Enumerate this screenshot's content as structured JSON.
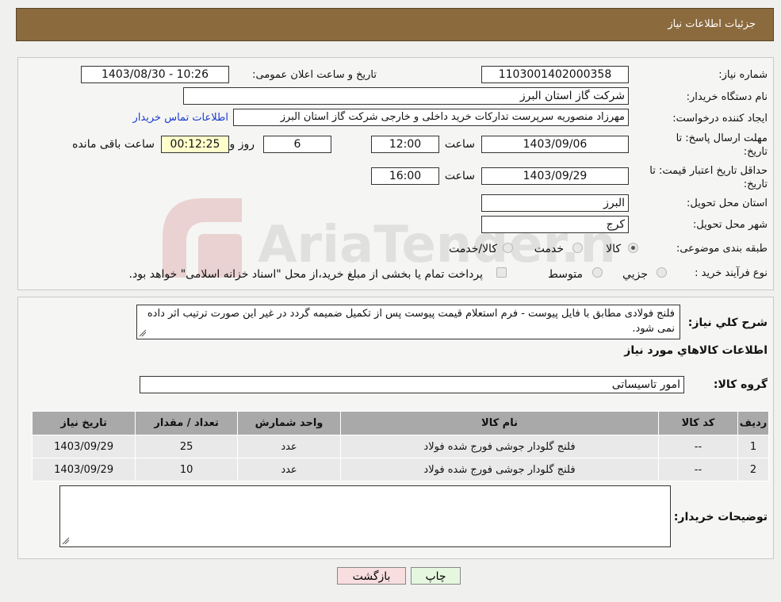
{
  "header": {
    "title": "جزئیات اطلاعات نیاز"
  },
  "watermark": {
    "brand": "AriaTender.neT"
  },
  "form": {
    "need_number": {
      "label": "شماره نیاز:",
      "value": "1103001402000358"
    },
    "announce_datetime": {
      "label": "تاریخ و ساعت اعلان عمومی:",
      "value": "1403/08/30 - 10:26"
    },
    "buyer_org": {
      "label": "نام دستگاه خریدار:",
      "value": "شرکت گاز استان البرز"
    },
    "requester": {
      "label": "ایجاد کننده درخواست:",
      "value": "مهرزاد منصوریه سرپرست تدارکات خرید داخلی و خارجی شرکت گاز استان البرز",
      "contact_link": "اطلاعات تماس خریدار"
    },
    "reply_deadline": {
      "label_line1": "مهلت ارسال پاسخ: تا",
      "label_line2": "تاریخ:",
      "date": "1403/09/06",
      "time_label": "ساعت",
      "time": "12:00",
      "days": "6",
      "days_label": "روز و",
      "remaining": "00:12:25",
      "remaining_label": "ساعت باقی مانده"
    },
    "price_validity": {
      "label_line1": "حداقل تاریخ اعتبار قیمت: تا",
      "label_line2": "تاریخ:",
      "date": "1403/09/29",
      "time_label": "ساعت",
      "time": "16:00"
    },
    "province": {
      "label": "استان محل تحویل:",
      "value": "البرز"
    },
    "city": {
      "label": "شهر محل تحویل:",
      "value": "کرج"
    },
    "category": {
      "label": "طبقه بندی موضوعی:",
      "options": [
        "کالا",
        "خدمت",
        "کالا/خدمت"
      ],
      "selected": "کالا"
    },
    "purchase_type": {
      "label": "نوع فرآیند خرید :",
      "options": [
        "جزیي",
        "متوسط"
      ],
      "note": "پرداخت تمام یا بخشی از مبلغ خرید،از محل \"اسناد خزانه اسلامی\" خواهد بود."
    }
  },
  "summary": {
    "label": "شرح کلي نياز:",
    "text": "فلنج فولادی مطابق با فایل پیوست - فرم استعلام قیمت پیوست پس از تکمیل ضمیمه گردد در غیر این صورت ترتیب اثر داده نمی شود."
  },
  "goods": {
    "section_title": "اطلاعات کالاهاي مورد نياز",
    "group_label": "گروه کالا:",
    "group_value": "امور تاسیساتی",
    "columns": [
      "رديف",
      "کد کالا",
      "نام کالا",
      "واحد شمارش",
      "تعداد / مقدار",
      "تاريخ نياز"
    ],
    "rows": [
      {
        "index": "1",
        "code": "--",
        "name": "فلنج گلودار جوشی فورج شده فولاد",
        "unit": "عدد",
        "qty": "25",
        "date": "1403/09/29"
      },
      {
        "index": "2",
        "code": "--",
        "name": "فلنج گلودار جوشی فورج شده فولاد",
        "unit": "عدد",
        "qty": "10",
        "date": "1403/09/29"
      }
    ]
  },
  "buyer_notes": {
    "label": "توضیحات خریدار:",
    "value": ""
  },
  "buttons": {
    "print": "چاپ",
    "back": "بازگشت"
  }
}
